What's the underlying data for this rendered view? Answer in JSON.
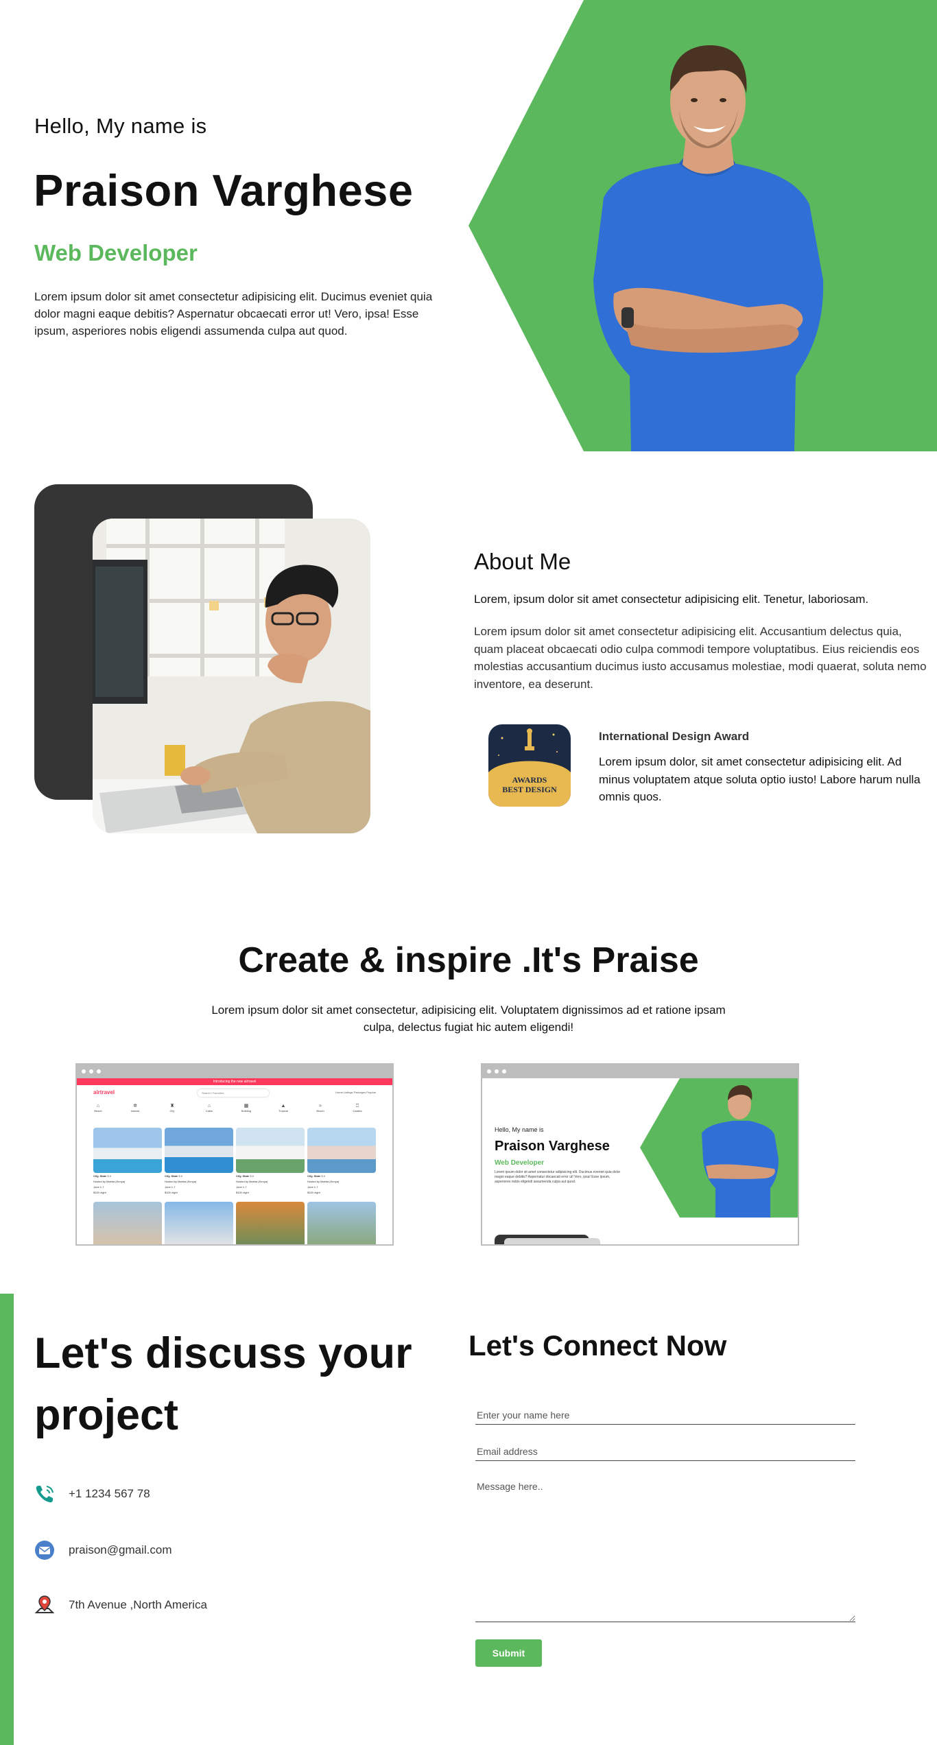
{
  "colors": {
    "accent": "#5cb85c",
    "dark": "#353535",
    "airtravel_brand": "#ff385c"
  },
  "hero": {
    "greeting": "Hello, My name is",
    "name": "Praison Varghese",
    "role": "Web Developer",
    "description": "Lorem ipsum dolor sit amet consectetur adipisicing elit. Ducimus eveniet quia dolor magni eaque debitis? Aspernatur obcaecati error ut! Vero, ipsa! Esse ipsum, asperiores nobis eligendi assumenda culpa aut quod."
  },
  "about": {
    "title": "About Me",
    "lead": "Lorem, ipsum dolor sit amet consectetur adipisicing elit. Tenetur, laboriosam.",
    "paragraph": "Lorem ipsum dolor sit amet consectetur adipisicing elit. Accusantium delectus quia, quam placeat obcaecati odio culpa commodi tempore voluptatibus. Eius reiciendis eos molestias accusantium ducimus iusto accusamus molestiae, modi quaerat, soluta nemo inventore, ea deserunt.",
    "award": {
      "title": "International Design Award",
      "description": "Lorem ipsum dolor, sit amet consectetur adipisicing elit. Ad minus voluptatem atque soluta optio iusto! Labore harum nulla omnis quos.",
      "badge_line1": "AWARDS",
      "badge_line2": "BEST DESIGN"
    }
  },
  "projects": {
    "title": "Create & inspire .It's Praise",
    "description": "Lorem ipsum dolor sit amet consectetur, adipisicing elit. Voluptatem dignissimos ad et ratione ipsam culpa, delectus fugiat hic autem eligendi!",
    "airtravel": {
      "logo": "airtravel",
      "banner": "Introducing the new airtravel",
      "search_placeholder": "Search / Favorites",
      "nav_links": "Home   Listings   Packages   Popular",
      "categories": [
        "Beach",
        "Islands",
        "City",
        "Cabin",
        "Building",
        "Tropical",
        "Beach",
        "Castles"
      ],
      "cards": [
        {
          "title": "City, State",
          "rating": "5.0",
          "host": "Hosted by Meeka (Kenya)",
          "dates": "June 1-7",
          "price": "$100 night"
        },
        {
          "title": "City, State",
          "rating": "5.0",
          "host": "Hosted by Meeka (Kenya)",
          "dates": "June 1-7",
          "price": "$100 night"
        },
        {
          "title": "City, State",
          "rating": "5.0",
          "host": "Hosted by Meeka (Kenya)",
          "dates": "June 1-7",
          "price": "$100 night"
        },
        {
          "title": "City, State",
          "rating": "5.0",
          "host": "Hosted by Meeka (Kenya)",
          "dates": "June 1-7",
          "price": "$100 night"
        }
      ]
    },
    "portfolio_preview": {
      "greeting": "Hello, My name is",
      "name": "Praison Varghese",
      "role": "Web Developer",
      "description": "Lorem ipsum dolor sit amet consectetur adipisicing elit. Ducimus eveniet quia dolor magni eaque debitis? Aspernatur obcaecati error ut! Vero, ipsa! Esse ipsum, asperiores nobis eligendi assumenda culpa aut quod."
    }
  },
  "contact": {
    "heading": "Let's discuss your project",
    "phone": "+1 1234 567 78",
    "email": "praison@gmail.com",
    "address": "7th Avenue ,North America",
    "form_title": "Let's Connect Now",
    "name_placeholder": "Enter your name here",
    "email_placeholder": "Email address",
    "message_placeholder": "Message here..",
    "submit_label": "Submit"
  }
}
